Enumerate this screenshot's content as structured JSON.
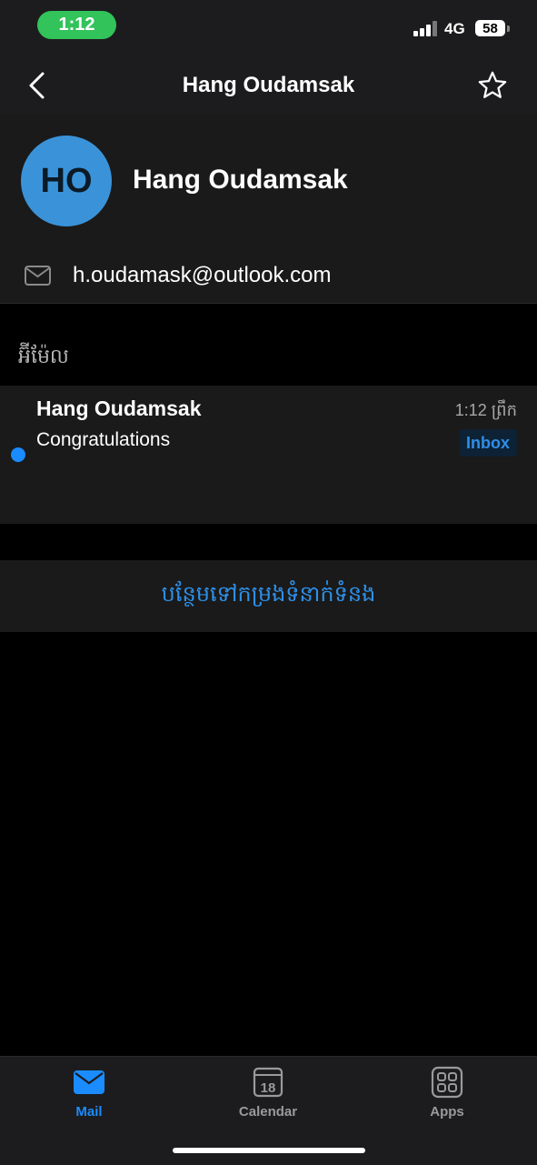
{
  "status_bar": {
    "time": "1:12",
    "network": "4G",
    "battery": "58"
  },
  "nav": {
    "title": "Hang Oudamsak",
    "back_icon": "chevron-left-icon",
    "favorite_icon": "star-icon"
  },
  "contact": {
    "initials": "HO",
    "name": "Hang Oudamsak",
    "email": "h.oudamask@outlook.com",
    "avatar_color": "#3a93d8"
  },
  "section": {
    "label": "អ៊ីម៉ែល"
  },
  "messages": [
    {
      "sender": "Hang Oudamsak",
      "time": "1:12 ព្រឹក",
      "subject": "Congratulations",
      "folder": "Inbox",
      "unread": true
    }
  ],
  "add_contact": {
    "label": "បន្ថែមទៅកម្រងទំនាក់ទំនង"
  },
  "tabs": [
    {
      "label": "Mail",
      "icon": "mail-icon",
      "active": true
    },
    {
      "label": "Calendar",
      "icon": "calendar-icon",
      "day": "18",
      "active": false
    },
    {
      "label": "Apps",
      "icon": "apps-grid-icon",
      "active": false
    }
  ],
  "colors": {
    "accent": "#1a8cff",
    "background": "#000000",
    "surface": "#1a1a1a"
  }
}
